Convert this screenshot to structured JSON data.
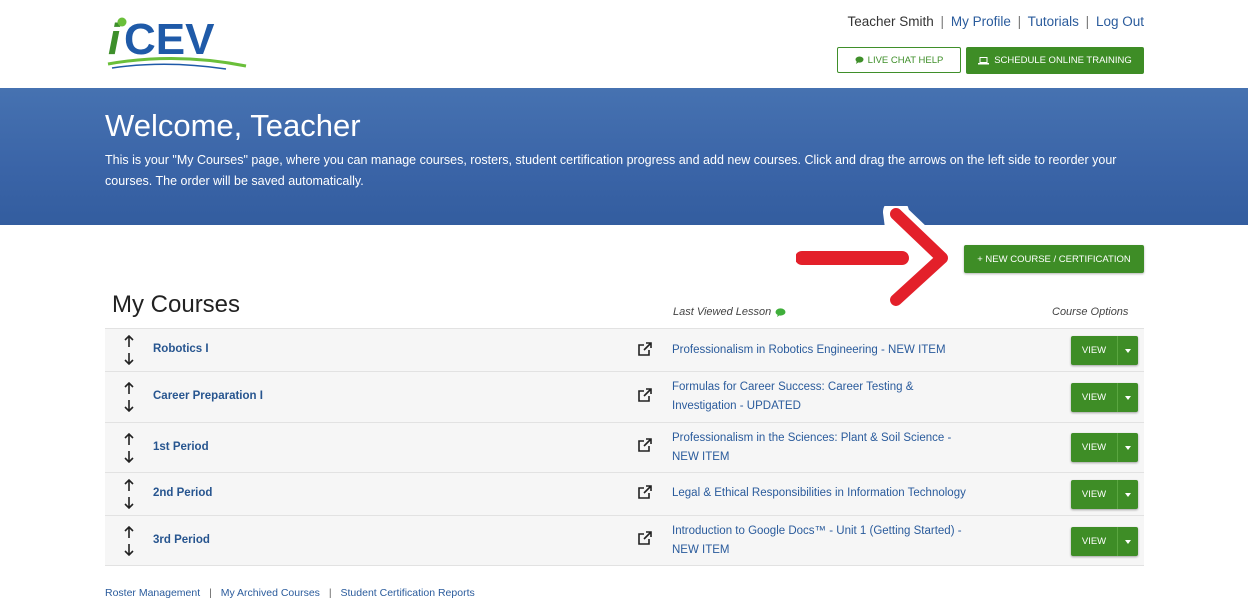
{
  "header": {
    "logo_text": "iCEV",
    "user_name": "Teacher Smith",
    "links": [
      "My Profile",
      "Tutorials",
      "Log Out"
    ],
    "separator": "|",
    "live_chat_label": "LIVE CHAT HELP",
    "schedule_training_label": "SCHEDULE ONLINE TRAINING"
  },
  "banner": {
    "title": "Welcome, Teacher",
    "description": "This is your \"My Courses\" page, where you can manage courses, rosters, student certification progress and add new courses. Click and drag the arrows on the left side to reorder your courses. The order will be saved automatically."
  },
  "new_course_label": "+ NEW COURSE / CERTIFICATION",
  "courses": {
    "title": "My Courses",
    "last_viewed_header": "Last Viewed Lesson",
    "options_header": "Course Options",
    "view_label": "VIEW",
    "rows": [
      {
        "name": "Robotics I",
        "lesson_line1": "Professionalism in Robotics Engineering - NEW ITEM",
        "lesson_line2": ""
      },
      {
        "name": "Career Preparation I",
        "lesson_line1": "Formulas for Career Success: Career Testing &",
        "lesson_line2": "Investigation - UPDATED"
      },
      {
        "name": "1st Period",
        "lesson_line1": "Professionalism in the Sciences: Plant & Soil Science -",
        "lesson_line2": "NEW ITEM"
      },
      {
        "name": "2nd Period",
        "lesson_line1": "Legal & Ethical Responsibilities in Information Technology",
        "lesson_line2": ""
      },
      {
        "name": "3rd Period",
        "lesson_line1": "Introduction to Google Docs™ - Unit 1 (Getting Started) -",
        "lesson_line2": "NEW ITEM"
      }
    ]
  },
  "footer": {
    "links": [
      "Roster Management",
      "My Archived Courses",
      "Student Certification Reports"
    ],
    "separator": "|"
  },
  "colors": {
    "brand_green": "#3e8d26",
    "banner_blue": "#3a64a7",
    "link_blue": "#2a5b9c",
    "arrow_red": "#e3202a"
  },
  "icons": {
    "handle": "up-down-arrows-icon",
    "external": "external-link-icon",
    "chat": "chat-bubble-icon",
    "laptop": "laptop-icon",
    "caret": "caret-down-icon"
  }
}
